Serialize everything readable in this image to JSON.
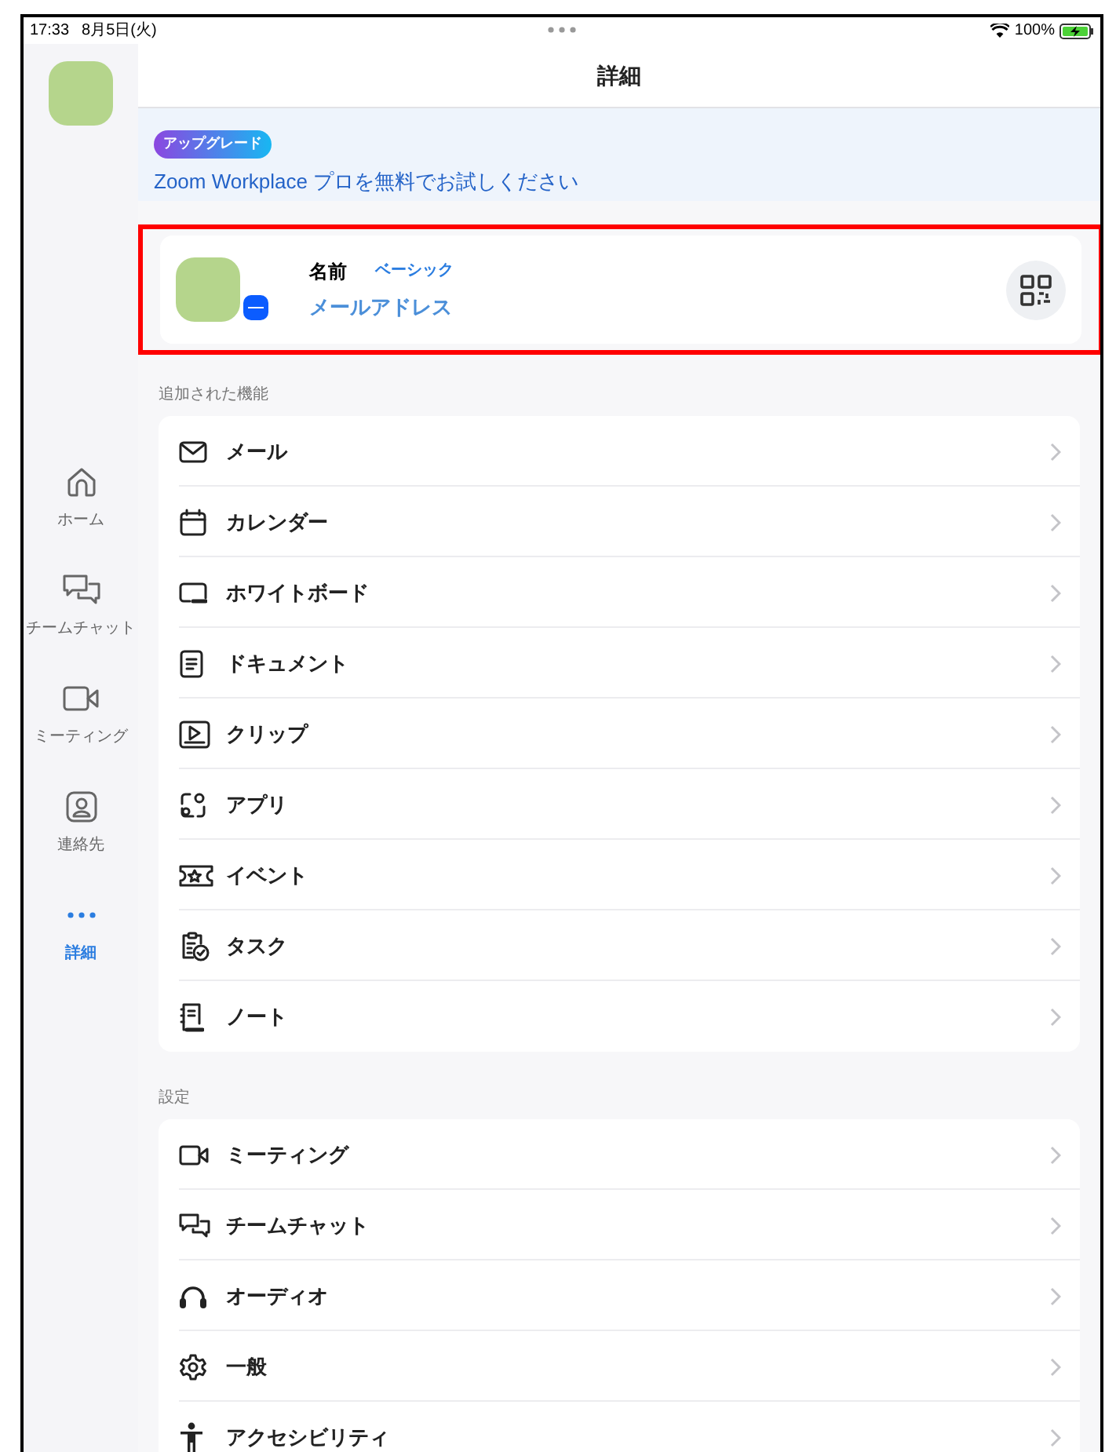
{
  "status_bar": {
    "time": "17:33",
    "date": "8月5日(火)",
    "battery": "100%"
  },
  "sidebar": {
    "items": [
      {
        "label": "ホーム",
        "selected": false
      },
      {
        "label": "チームチャット",
        "selected": false
      },
      {
        "label": "ミーティング",
        "selected": false
      },
      {
        "label": "連絡先",
        "selected": false
      },
      {
        "label": "詳細",
        "selected": true
      }
    ]
  },
  "header": {
    "title": "詳細"
  },
  "upgrade_banner": {
    "badge": "アップグレード",
    "text": "Zoom Workplace プロを無料でお試しください"
  },
  "profile": {
    "name": "名前",
    "plan": "ベーシック",
    "email": "メールアドレス",
    "highlighted": true
  },
  "sections": [
    {
      "title": "追加された機能",
      "items": [
        "メール",
        "カレンダー",
        "ホワイトボード",
        "ドキュメント",
        "クリップ",
        "アプリ",
        "イベント",
        "タスク",
        "ノート"
      ]
    },
    {
      "title": "設定",
      "items": [
        "ミーティング",
        "チームチャット",
        "オーディオ",
        "一般",
        "アクセシビリティ"
      ]
    }
  ]
}
